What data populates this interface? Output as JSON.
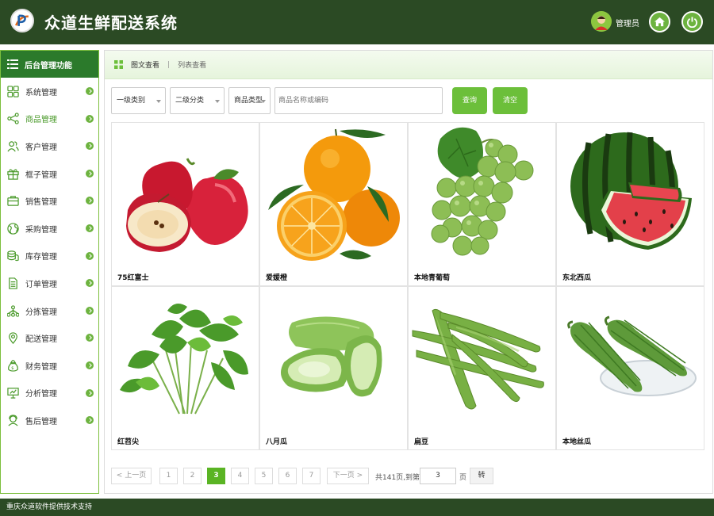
{
  "header": {
    "title": "众道生鲜配送系统",
    "user_label": "管理员",
    "home_icon": "home-icon",
    "power_icon": "power-icon"
  },
  "sidebar": {
    "title": "后台管理功能",
    "items": [
      {
        "label": "系统管理",
        "icon": "grid-icon"
      },
      {
        "label": "商品管理",
        "icon": "share-icon",
        "active": true
      },
      {
        "label": "客户管理",
        "icon": "users-icon"
      },
      {
        "label": "框子管理",
        "icon": "gift-icon"
      },
      {
        "label": "销售管理",
        "icon": "briefcase-icon"
      },
      {
        "label": "采购管理",
        "icon": "globe-icon"
      },
      {
        "label": "库存管理",
        "icon": "coins-icon"
      },
      {
        "label": "订单管理",
        "icon": "document-icon"
      },
      {
        "label": "分拣管理",
        "icon": "sitemap-icon"
      },
      {
        "label": "配送管理",
        "icon": "map-pin-icon"
      },
      {
        "label": "财务管理",
        "icon": "money-bag-icon"
      },
      {
        "label": "分析管理",
        "icon": "presentation-icon"
      },
      {
        "label": "售后管理",
        "icon": "support-icon"
      }
    ]
  },
  "tabs": {
    "active": "图文查看",
    "inactive": "列表查看"
  },
  "filters": {
    "category1": "一级类别",
    "category2": "二级分类",
    "product_type": "商品类型",
    "search_placeholder": "商品名称或编码",
    "query_label": "查询",
    "clear_label": "清空"
  },
  "products": [
    {
      "name": "75红富士",
      "image": "apple"
    },
    {
      "name": "爱媛橙",
      "image": "orange"
    },
    {
      "name": "本地青葡萄",
      "image": "grape"
    },
    {
      "name": "东北西瓜",
      "image": "watermelon"
    },
    {
      "name": "红苕尖",
      "image": "sweet-potato-leaves"
    },
    {
      "name": "八月瓜",
      "image": "chayote"
    },
    {
      "name": "扁豆",
      "image": "flat-bean"
    },
    {
      "name": "本地丝瓜",
      "image": "loofah"
    }
  ],
  "pagination": {
    "prev": "< 上一页",
    "pages": [
      "1",
      "2",
      "3",
      "4",
      "5",
      "6",
      "7"
    ],
    "current": "3",
    "next": "下一页 >",
    "total_text": "共141页,到第",
    "jump_value": "3",
    "page_unit": "页",
    "go_label": "转"
  },
  "footer": {
    "text": "重庆众道软件提供技术支持"
  },
  "colors": {
    "header_bg": "#2b4a24",
    "accent": "#6cbf3a",
    "sidebar_head": "#2b7a2b"
  }
}
